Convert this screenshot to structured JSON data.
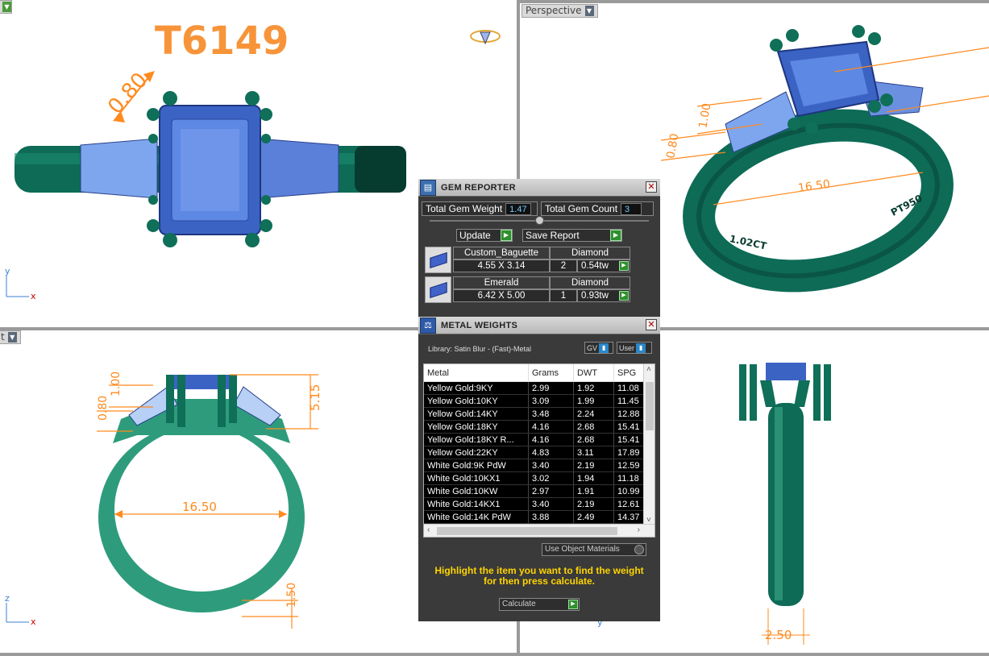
{
  "viewports": {
    "top": {
      "label": "",
      "model_code": "T6149",
      "dim_a": "0.80",
      "axis_y": "y",
      "axis_x": "x"
    },
    "perspective": {
      "label": "Perspective",
      "dim_size": "16.50",
      "dim_a": "1.00",
      "dim_b": "0.80",
      "stamp_weight": "1.02CT",
      "stamp_metal": "PT950"
    },
    "front": {
      "label": "t",
      "dim_inner": "16.50",
      "dim_height": "5.15",
      "dim_a": "1.00",
      "dim_b": "0.80",
      "dim_band": "1.50",
      "axis_z": "z",
      "axis_x": "x"
    },
    "right": {
      "dim_width": "2.50",
      "axis_y": "y"
    }
  },
  "gem_reporter": {
    "title": "GEM REPORTER",
    "total_weight_label": "Total Gem Weight",
    "total_weight_value": "1.47",
    "total_count_label": "Total Gem Count",
    "total_count_value": "3",
    "update_label": "Update",
    "save_label": "Save Report",
    "gems": [
      {
        "name": "Custom_Baguette",
        "material": "Diamond",
        "dims": "4.55 X 3.14",
        "count": "2",
        "weight": "0.54tw"
      },
      {
        "name": "Emerald",
        "material": "Diamond",
        "dims": "6.42 X 5.00",
        "count": "1",
        "weight": "0.93tw"
      }
    ]
  },
  "metal_weights": {
    "title": "METAL WEIGHTS",
    "library": "Library: Satin Blur - (Fast)-Metal",
    "toggle_gv": "GV",
    "toggle_user": "User",
    "columns": [
      "Metal",
      "Grams",
      "DWT",
      "SPG"
    ],
    "rows": [
      [
        "Yellow Gold:9KY",
        "2.99",
        "1.92",
        "11.08"
      ],
      [
        "Yellow Gold:10KY",
        "3.09",
        "1.99",
        "11.45"
      ],
      [
        "Yellow Gold:14KY",
        "3.48",
        "2.24",
        "12.88"
      ],
      [
        "Yellow Gold:18KY",
        "4.16",
        "2.68",
        "15.41"
      ],
      [
        "Yellow Gold:18KY R...",
        "4.16",
        "2.68",
        "15.41"
      ],
      [
        "Yellow Gold:22KY",
        "4.83",
        "3.11",
        "17.89"
      ],
      [
        "White Gold:9K PdW",
        "3.40",
        "2.19",
        "12.59"
      ],
      [
        "White Gold:10KX1",
        "3.02",
        "1.94",
        "11.18"
      ],
      [
        "White Gold:10KW",
        "2.97",
        "1.91",
        "10.99"
      ],
      [
        "White Gold:14KX1",
        "3.40",
        "2.19",
        "12.61"
      ],
      [
        "White Gold:14K PdW",
        "3.88",
        "2.49",
        "14.37"
      ]
    ],
    "use_object_label": "Use Object Materials",
    "hint_line1": "Highlight the item you want to find the weight",
    "hint_line2": "for then press calculate.",
    "calculate_label": "Calculate"
  },
  "colors": {
    "dimension": "#ff8a1e",
    "metal": "#0c6a55",
    "gem": "#4a78d6",
    "title": "#f7943a"
  }
}
